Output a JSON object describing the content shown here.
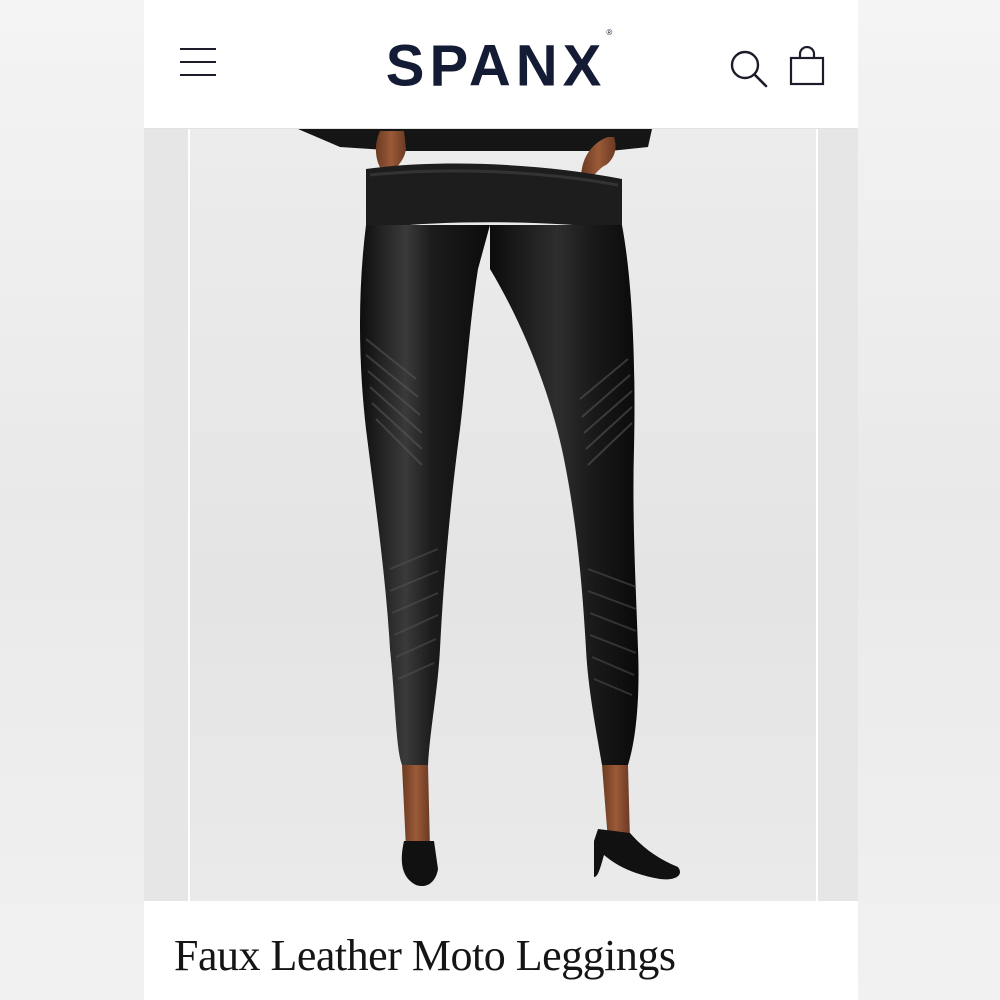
{
  "header": {
    "brand": "SPANX",
    "brand_mark": "®",
    "menu_icon": "hamburger-menu-icon",
    "search_icon": "search-icon",
    "bag_icon": "shopping-bag-icon"
  },
  "product": {
    "title": "Faux Leather Moto Leggings",
    "image_alt": "black faux leather moto leggings on model"
  },
  "colors": {
    "brand_navy": "#141b34",
    "legging_black": "#151515",
    "background": "#efefef"
  }
}
